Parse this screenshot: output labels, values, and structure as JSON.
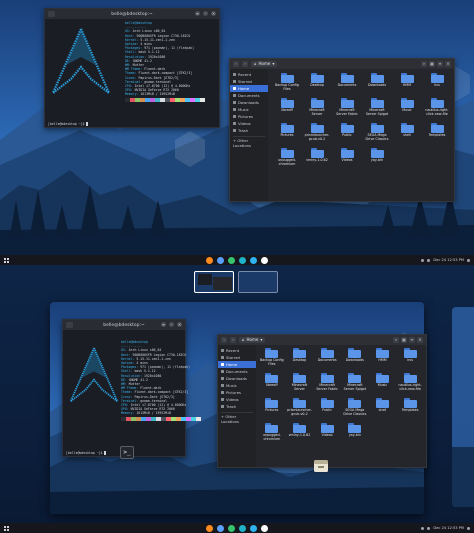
{
  "terminal": {
    "title": "belle@bdesktop:~",
    "prompt": "[belle@bdesktop ~]$",
    "info": [
      {
        "key": "belle@bdesktop",
        "val": ""
      },
      {
        "key": "-----------",
        "val": ""
      },
      {
        "key": "OS:",
        "val": "Arch Linux x86_64"
      },
      {
        "key": "Host:",
        "val": "90QB000SFR Legion C730-18ICO"
      },
      {
        "key": "Kernel:",
        "val": "5.15.11-zen1-1-zen"
      },
      {
        "key": "Uptime:",
        "val": "4 mins"
      },
      {
        "key": "Packages:",
        "val": "971 (pacman), 11 (flatpak)"
      },
      {
        "key": "Shell:",
        "val": "bash 5.1.12"
      },
      {
        "key": "Resolution:",
        "val": "1920x1080"
      },
      {
        "key": "DE:",
        "val": "GNOME 41.2"
      },
      {
        "key": "WM:",
        "val": "Mutter"
      },
      {
        "key": "WM Theme:",
        "val": "Fluent-dark"
      },
      {
        "key": "Theme:",
        "val": "Fluent-dark-compact [GTK2/3]"
      },
      {
        "key": "Icons:",
        "val": "Papirus-Dark [GTK2/3]"
      },
      {
        "key": "Terminal:",
        "val": "gnome-terminal"
      },
      {
        "key": "CPU:",
        "val": "Intel i7-8700 (12) @ 4.600GHz"
      },
      {
        "key": "GPU:",
        "val": "NVIDIA GeForce RTX 2060"
      },
      {
        "key": "Memory:",
        "val": "1613MiB / 15952MiB"
      }
    ],
    "palette": [
      "#2b2d33",
      "#e05561",
      "#8cc265",
      "#d18f52",
      "#4aa5f0",
      "#c162de",
      "#42b3c2",
      "#d7dae0",
      "#4f545c",
      "#ff616e",
      "#a5e075",
      "#f0a45d",
      "#4dc4ff",
      "#de73ff",
      "#4cd1e0",
      "#e6e6e6"
    ]
  },
  "filemanager": {
    "path": "Home",
    "sidebar": [
      {
        "label": "Recent",
        "active": false
      },
      {
        "label": "Starred",
        "active": false
      },
      {
        "label": "Home",
        "active": true
      },
      {
        "label": "Documents",
        "active": false
      },
      {
        "label": "Downloads",
        "active": false
      },
      {
        "label": "Music",
        "active": false
      },
      {
        "label": "Pictures",
        "active": false
      },
      {
        "label": "Videos",
        "active": false
      },
      {
        "label": "Trash",
        "active": false
      }
    ],
    "other_locations": "+ Other Locations",
    "items": [
      "Backup Config Files",
      "Desktop",
      "Documents",
      "Downloads",
      "HMM",
      "kvs",
      "libreoff",
      "Minecraft Server",
      "Minecraft Server Fabric",
      "Minecraft Server Spigot",
      "Music",
      "nautilus-right-click-new-file",
      "Pictures",
      "prismlauncher-gcub-v0.2",
      "Public",
      "SEGA Mega Drive Classics",
      "shell",
      "Templates",
      "unpugged-chromium",
      "vminy-1.0.62",
      "Videos",
      "yay-bin"
    ]
  },
  "panel": {
    "clock": "Dec 24  12:53 PM",
    "dock_colors": [
      "#ff8a1e",
      "#5aa0ff",
      "#36c46e",
      "#20b2c9",
      "#2fb2f0",
      "#ffffff"
    ]
  }
}
